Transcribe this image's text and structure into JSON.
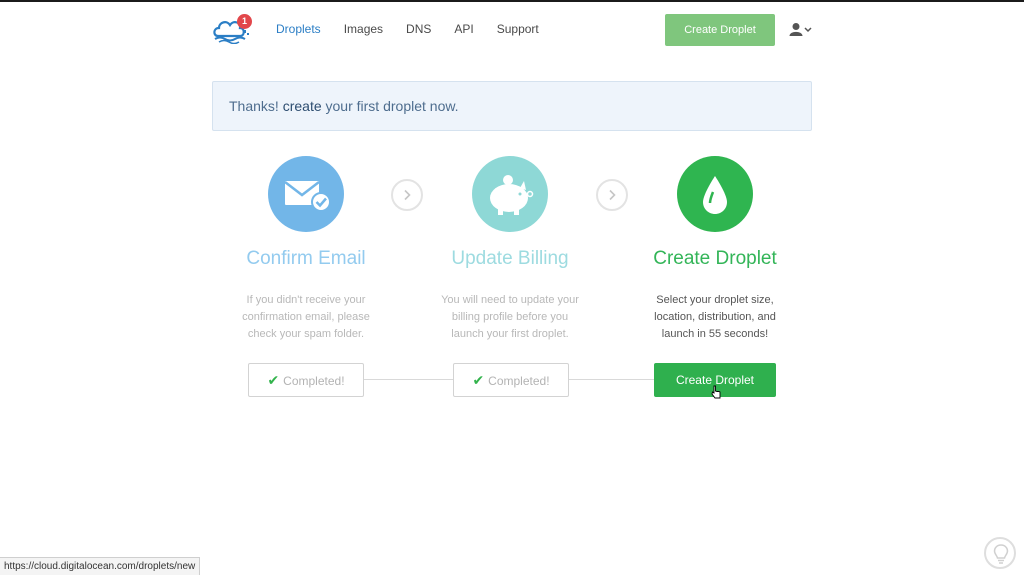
{
  "header": {
    "notification_count": "1",
    "nav": [
      {
        "label": "Droplets",
        "active": true
      },
      {
        "label": "Images",
        "active": false
      },
      {
        "label": "DNS",
        "active": false
      },
      {
        "label": "API",
        "active": false
      },
      {
        "label": "Support",
        "active": false
      }
    ],
    "create_button": "Create Droplet"
  },
  "banner": {
    "prefix": "Thanks! ",
    "emphasis": "create",
    "suffix": " your first droplet now."
  },
  "steps": [
    {
      "title": "Confirm Email",
      "description": "If you didn't receive your confirmation email, please check your spam folder.",
      "button": "Completed!",
      "icon": "envelope-check-icon"
    },
    {
      "title": "Update Billing",
      "description": "You will need to update your billing profile before you launch your first droplet.",
      "button": "Completed!",
      "icon": "piggy-bank-icon"
    },
    {
      "title": "Create Droplet",
      "description": "Select your droplet size, location, distribution, and launch in 55 seconds!",
      "button": "Create Droplet",
      "icon": "droplet-icon"
    }
  ],
  "status_bar": {
    "url": "https://cloud.digitalocean.com/droplets/new"
  },
  "colors": {
    "accent_green": "#2fb04e",
    "accent_blue": "#2b7ec5",
    "step1": "#72b6e8",
    "step2": "#8ed8d6",
    "step3": "#2fb550"
  }
}
